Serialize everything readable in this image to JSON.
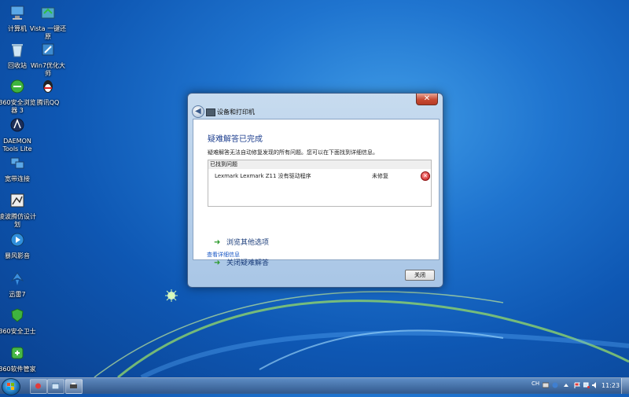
{
  "desktop": {
    "icons": [
      {
        "label": "计算机",
        "icon": "computer-icon"
      },
      {
        "label": "Vista 一键还原",
        "icon": "vista-restore-icon"
      },
      {
        "label": "回收站",
        "icon": "recycle-bin-icon"
      },
      {
        "label": "Win7优化大师",
        "icon": "win7-optimizer-icon"
      },
      {
        "label": "360安全浏览器 3",
        "icon": "360-browser-icon"
      },
      {
        "label": "腾讯QQ",
        "icon": "qq-icon"
      },
      {
        "label": "DAEMON Tools Lite",
        "icon": "daemon-tools-icon"
      },
      {
        "label": "宽带连接",
        "icon": "broadband-icon"
      },
      {
        "label": "凌波腾仿设计划",
        "icon": "lingbo-icon"
      },
      {
        "label": "暴风影音",
        "icon": "baofeng-icon"
      },
      {
        "label": "迅雷7",
        "icon": "xunlei-icon"
      },
      {
        "label": "360安全卫士",
        "icon": "360-safe-icon"
      },
      {
        "label": "360软件管家",
        "icon": "360-software-icon"
      }
    ]
  },
  "window": {
    "address": "设备和打印机",
    "close_glyph": "✕",
    "heading": "疑难解答已完成",
    "subtitle": "疑难解答无法自动修复发现的所有问题。您可以在下面找到详细信息。",
    "problems_header": "已找到问题",
    "problems": [
      {
        "name": "Lexmark Lexmark Z11 没有驱动程序",
        "status": "未修复"
      }
    ],
    "options": [
      {
        "label": "浏览其他选项"
      },
      {
        "label": "关闭疑难解答"
      }
    ],
    "details_link": "查看详细信息",
    "close_button": "关闭"
  },
  "taskbar": {
    "language": "CH",
    "clock": "11:23"
  },
  "colors": {
    "desktop_blue": "#1f74cf",
    "heading_blue": "#1e3f8f",
    "option_arrow_green": "#2c9a2c",
    "error_red": "#c41919"
  }
}
